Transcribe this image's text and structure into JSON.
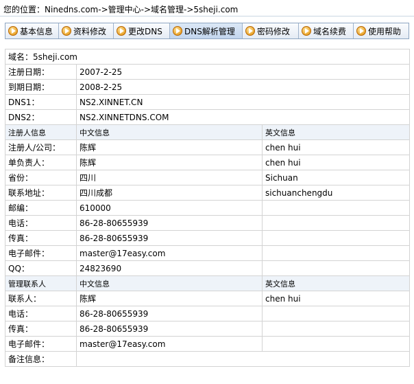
{
  "breadcrumb": {
    "prefix": "您的位置：",
    "path": "Ninedns.com->管理中心->域名管理->5sheji.com"
  },
  "tabs": [
    {
      "label": "基本信息",
      "active": false
    },
    {
      "label": "资料修改",
      "active": false
    },
    {
      "label": "更改DNS",
      "active": false
    },
    {
      "label": "DNS解析管理",
      "active": true
    },
    {
      "label": "密码修改",
      "active": false
    },
    {
      "label": "域名续费",
      "active": false
    },
    {
      "label": "使用帮助",
      "active": false
    }
  ],
  "info": {
    "domain": "域名：5sheji.com",
    "reg_date_label": "注册日期：",
    "reg_date": "2007-2-25",
    "exp_date_label": "到期日期：",
    "exp_date": "2008-2-25",
    "dns1_label": "DNS1：",
    "dns1": "NS2.XINNET.CN",
    "dns2_label": "DNS2：",
    "dns2": "NS2.XINNETDNS.COM"
  },
  "registrant": {
    "header": "注册人信息",
    "col_cn": "中文信息",
    "col_en": "英文信息",
    "rows": [
      {
        "label": "注册人/公司：",
        "cn": "陈辉",
        "en": "chen hui"
      },
      {
        "label": "单负责人：",
        "cn": "陈辉",
        "en": "chen hui"
      },
      {
        "label": "省份：",
        "cn": "四川",
        "en": "Sichuan"
      },
      {
        "label": "联系地址：",
        "cn": "四川成都",
        "en": "sichuanchengdu"
      },
      {
        "label": "邮编：",
        "cn": "610000",
        "en": ""
      },
      {
        "label": "电话：",
        "cn": "86-28-80655939",
        "en": ""
      },
      {
        "label": "传真：",
        "cn": "86-28-80655939",
        "en": ""
      },
      {
        "label": "电子邮件：",
        "cn": "master@17easy.com",
        "en": ""
      },
      {
        "label": "QQ：",
        "cn": "24823690",
        "en": ""
      }
    ]
  },
  "admin": {
    "header": "管理联系人",
    "col_cn": "中文信息",
    "col_en": "英文信息",
    "rows": [
      {
        "label": "联系人：",
        "cn": "陈辉",
        "en": "chen hui"
      },
      {
        "label": "电话：",
        "cn": "86-28-80655939",
        "en": ""
      },
      {
        "label": "传真：",
        "cn": "86-28-80655939",
        "en": ""
      },
      {
        "label": "电子邮件：",
        "cn": "master@17easy.com",
        "en": ""
      }
    ]
  },
  "remark": {
    "label": "备注信息：",
    "value": ""
  }
}
